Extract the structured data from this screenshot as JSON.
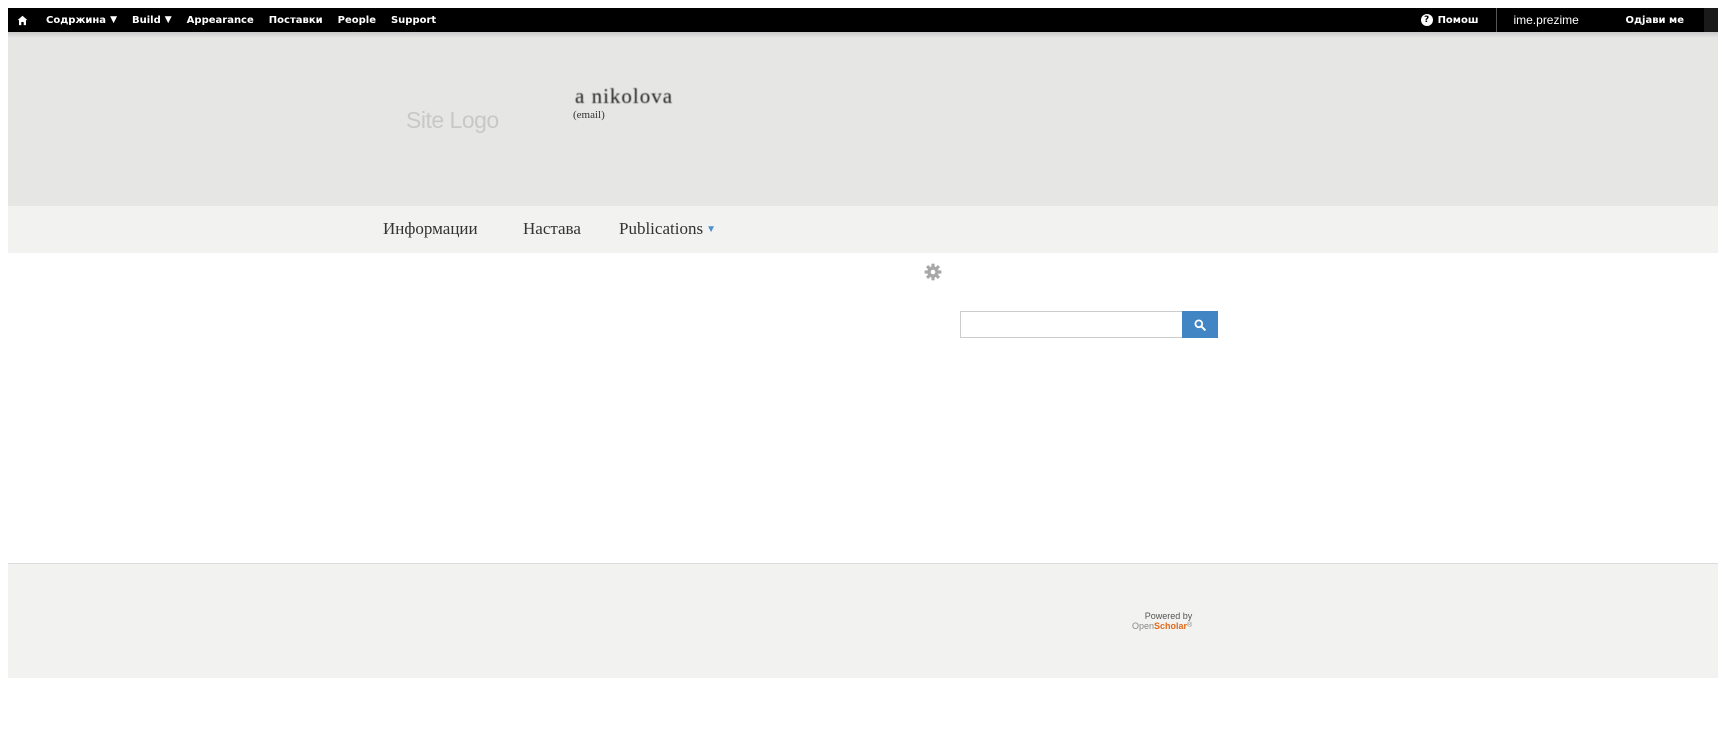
{
  "toolbar": {
    "items": [
      {
        "label": "Содржина",
        "has_caret": true
      },
      {
        "label": "Build",
        "has_caret": true
      },
      {
        "label": "Appearance",
        "has_caret": false
      },
      {
        "label": "Поставки",
        "has_caret": false
      },
      {
        "label": "People",
        "has_caret": false
      },
      {
        "label": "Support",
        "has_caret": false
      }
    ],
    "help_label": "Помош",
    "username": "ime.prezime",
    "logout_label": "Одјави ме",
    "caret_glyph": "▼",
    "home_icon": "home-icon",
    "help_icon": "question-circle-icon"
  },
  "header": {
    "site_logo_text": "Site Logo",
    "site_name": "a nikolova",
    "site_email": "(email)"
  },
  "nav": {
    "items": [
      {
        "label": "Информации"
      },
      {
        "label": "Настава"
      },
      {
        "label": "Publications",
        "caret": "▼"
      }
    ]
  },
  "content": {
    "settings_icon": "gear-icon",
    "search": {
      "value": "",
      "placeholder": "",
      "button_icon": "search-icon"
    }
  },
  "footer": {
    "powered_by": "Powered by",
    "brand_open": "Open",
    "brand_scholar": "Scholar",
    "brand_reg": "®"
  },
  "colors": {
    "toolbar_bg": "#000000",
    "header_bg": "#e6e6e5",
    "nav_bg": "#f2f2f0",
    "footer_bg": "#f2f2f0",
    "accent": "#4285c4",
    "brand_orange": "#e06a1b"
  }
}
